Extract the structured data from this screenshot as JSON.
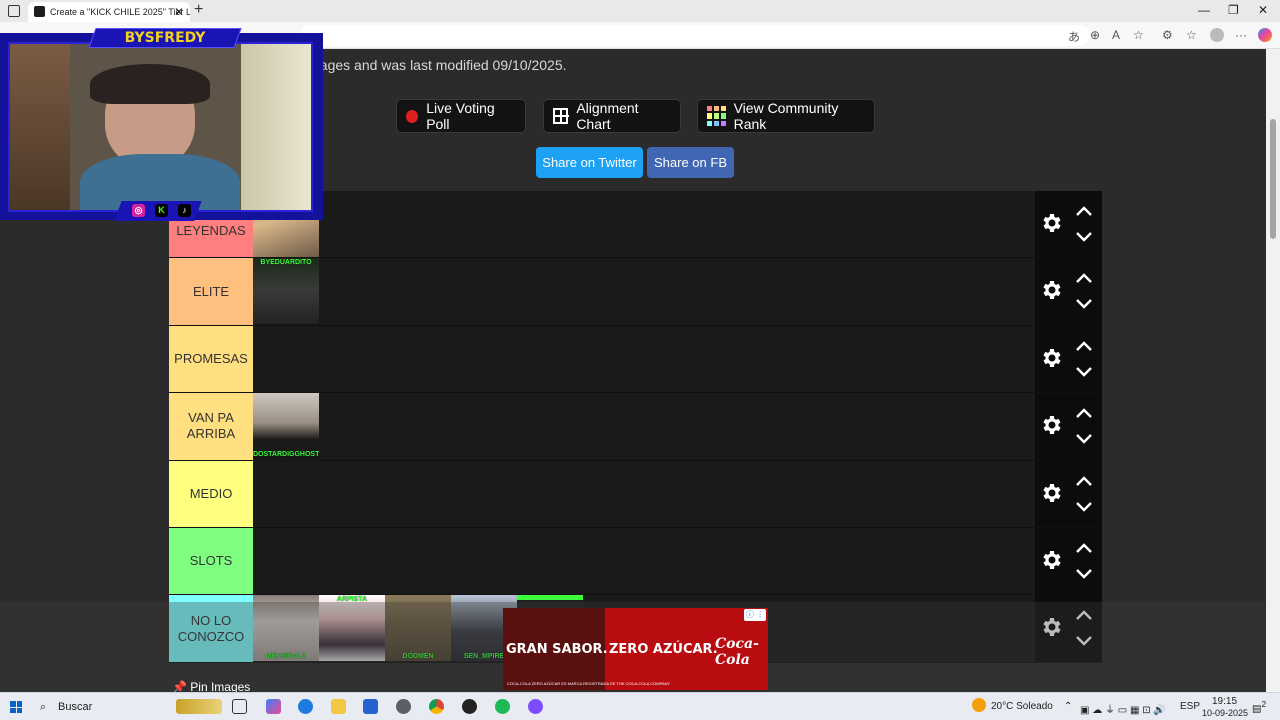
{
  "browser": {
    "tab_title": "Create a \"KICK CHILE 2025\" Tier L",
    "new_tab": "+",
    "close_tab": "✕",
    "minimize": "—",
    "maximize": "❐",
    "close_window": "✕"
  },
  "page": {
    "info_text": "nages and was last modified 09/10/2025.",
    "buttons": {
      "live_voting": "Live Voting Poll",
      "alignment": "Alignment Chart",
      "community": "View Community Rank"
    },
    "share": {
      "twitter": "Share on Twitter",
      "facebook": "Share on FB"
    },
    "pin_images": "Pin Images"
  },
  "tiers": [
    {
      "label": "LEYENDAS",
      "label_visible": "...LEYE\nNDAS",
      "color": "#ff7f7f",
      "images": [
        {
          "name": "dog-photo",
          "caption": ""
        }
      ]
    },
    {
      "label": "ELITE",
      "color": "#ffbf7f",
      "images": [
        {
          "name": "byeduardito",
          "caption": "BYEDUARDITO"
        }
      ]
    },
    {
      "label": "PROMESAS",
      "color": "#ffdf7f",
      "images": []
    },
    {
      "label": "VAN PA ARRIBA",
      "color": "#ffff7f",
      "images": [
        {
          "name": "mirror-selfie",
          "caption": "DOSTARDIGGHOST"
        }
      ]
    },
    {
      "label": "MEDIO",
      "color": "#ffff7f",
      "images": []
    },
    {
      "label": "SLOTS",
      "color": "#7fff7f",
      "images": []
    },
    {
      "label": "NO LO CONOZCO",
      "color": "#7fffff",
      "images": [
        {
          "name": "pink-hoodie",
          "caption": "MEKSIBALZ"
        },
        {
          "name": "anime-avatar",
          "caption": "ARPISTA"
        },
        {
          "name": "camo-jacket",
          "caption": "DODMEN"
        },
        {
          "name": "sunglasses-guy",
          "caption": "SEN_MPIRE"
        },
        {
          "name": "partial-image",
          "caption": ""
        }
      ]
    }
  ],
  "overlay": {
    "streamer_name": "BYSFREDY",
    "socials": [
      "instagram",
      "kick",
      "tiktok"
    ]
  },
  "ad": {
    "left_text": "GRAN SABOR.",
    "right_text": "ZERO AZÚCAR.",
    "brand": "Coca-Cola",
    "fine_print": "COCA-COLA ZERO AZÚCAR ES MARCA REGISTRADA DE THE COCA-COLA COMPANY"
  },
  "taskbar": {
    "search": "Buscar",
    "weather": "20°C  Soleado",
    "lang": "ESP",
    "time": "19:15",
    "date": "10-09-2025",
    "notifications": "2"
  },
  "colors": {
    "twitter": "#1da1f2",
    "facebook": "#3b5998",
    "overlay_blue": "#1a14b5",
    "overlay_gold": "#f3d21c"
  }
}
